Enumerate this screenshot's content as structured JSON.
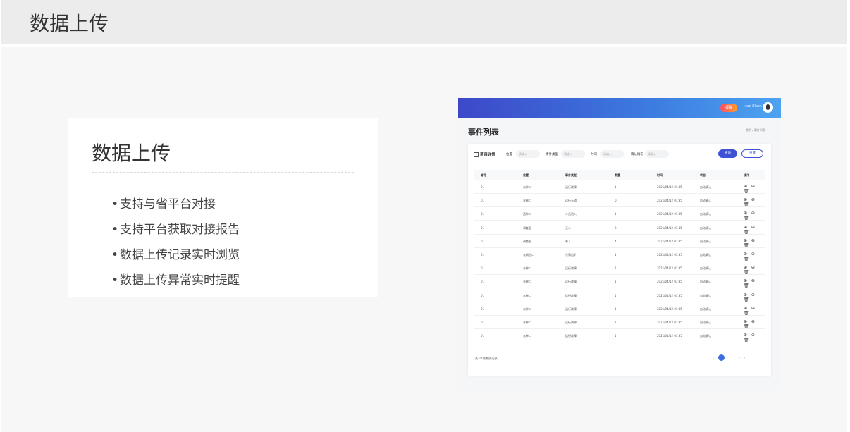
{
  "page": {
    "title": "数据上传"
  },
  "card": {
    "title": "数据上传",
    "features": [
      "支持与省平台对接",
      "支持平台获取对接报告",
      "数据上传记录实时浏览",
      "数据上传异常实时提醒"
    ]
  },
  "preview": {
    "topbar": {
      "alarm_label": "报警",
      "user_name": "Ivan Black"
    },
    "title": "事件列表",
    "breadcrumb": "首页 / 事件列表",
    "filters": {
      "detail_label": "项目详情",
      "location_label": "位置",
      "location_placeholder": "请输入",
      "type_label": "事件类型",
      "type_placeholder": "请输入",
      "time_label": "时间",
      "time_placeholder": "请输入",
      "confirm_label": "确认情况",
      "confirm_placeholder": "请输入",
      "query_button": "查询",
      "reset_button": "重置"
    },
    "table": {
      "headers": [
        "编号",
        "位置",
        "事件类型",
        "数量",
        "时间",
        "状态",
        "操作"
      ],
      "rows": [
        [
          "01",
          "东单口",
          "运行故障",
          "1",
          "2021/04/12 03:35",
          "自动确认"
        ],
        [
          "01",
          "东单口",
          "运行无碍",
          "0",
          "2021/04/12 03:35",
          "自动确认"
        ],
        [
          "01",
          "西单口",
          "人员进入",
          "1",
          "2021/04/12 03:35",
          "自动确认"
        ],
        [
          "01",
          "调查室",
          "无人",
          "0",
          "2021/04/12 03:35",
          "自动确认"
        ],
        [
          "01",
          "调查室",
          "有人",
          "4",
          "2021/04/12 03:35",
          "自动确认"
        ],
        [
          "01",
          "东钢出口",
          "东钢出矿",
          "1",
          "2021/04/12 03:35",
          "自动确认"
        ],
        [
          "01",
          "东单口",
          "运行故障",
          "1",
          "2021/04/12 03:35",
          "自动确认"
        ],
        [
          "01",
          "东单口",
          "运行故障",
          "1",
          "2021/04/12 03:35",
          "自动确认"
        ],
        [
          "01",
          "东单口",
          "运行故障",
          "1",
          "2021/04/12 03:35",
          "自动确认"
        ],
        [
          "01",
          "东单口",
          "运行故障",
          "1",
          "2021/04/12 03:35",
          "自动确认"
        ],
        [
          "01",
          "东单口",
          "运行故障",
          "1",
          "2021/04/12 03:35",
          "自动确认"
        ],
        [
          "01",
          "东单口",
          "运行故障",
          "1",
          "2021/04/12 03:35",
          "自动确认"
        ]
      ],
      "row_ops": "⊕ ⊖ 🗑"
    },
    "footer": {
      "total": "共100条相关记录",
      "pages": [
        "‹",
        "1",
        "2",
        "3",
        "›",
        "›"
      ]
    }
  }
}
